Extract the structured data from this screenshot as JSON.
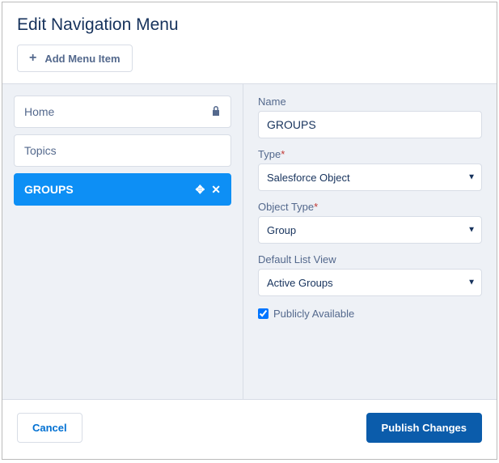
{
  "dialog": {
    "title": "Edit Navigation Menu"
  },
  "toolbar": {
    "add_label": "Add Menu Item"
  },
  "menu": {
    "items": [
      {
        "label": "Home",
        "locked": true,
        "selected": false
      },
      {
        "label": "Topics",
        "locked": false,
        "selected": false
      },
      {
        "label": "GROUPS",
        "locked": false,
        "selected": true
      }
    ]
  },
  "form": {
    "name_label": "Name",
    "name_value": "GROUPS",
    "type_label": "Type",
    "type_value": "Salesforce Object",
    "object_type_label": "Object Type",
    "object_type_value": "Group",
    "default_list_view_label": "Default List View",
    "default_list_view_value": "Active Groups",
    "publicly_available_label": "Publicly Available",
    "publicly_available_checked": true,
    "required_marker": "*"
  },
  "footer": {
    "cancel_label": "Cancel",
    "publish_label": "Publish Changes"
  }
}
